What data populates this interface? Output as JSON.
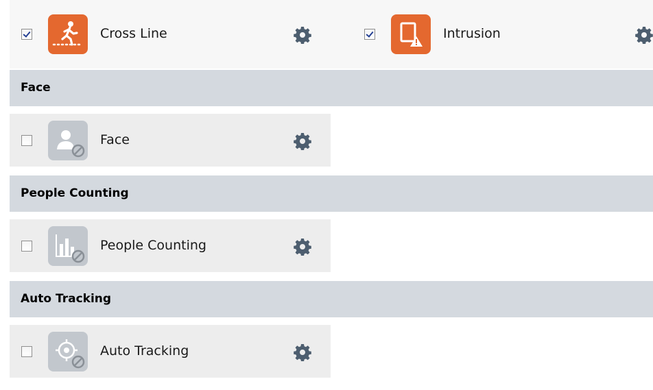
{
  "colors": {
    "row_background": "#ededed",
    "section_header_background": "#d4d9df",
    "active_tile": "#e4682f",
    "disabled_tile": "#c2c7cd",
    "gear": "#4d5e6f",
    "check": "#243f93"
  },
  "top_row": {
    "items": [
      {
        "label": "Cross Line",
        "checked": true,
        "icon": "cross-line-icon",
        "state": "active"
      },
      {
        "label": "Intrusion",
        "checked": true,
        "icon": "intrusion-icon",
        "state": "active"
      }
    ]
  },
  "sections": [
    {
      "header": "Face",
      "item": {
        "label": "Face",
        "checked": false,
        "icon": "face-icon",
        "state": "disabled"
      }
    },
    {
      "header": "People Counting",
      "item": {
        "label": "People Counting",
        "checked": false,
        "icon": "people-counting-icon",
        "state": "disabled"
      }
    },
    {
      "header": "Auto Tracking",
      "item": {
        "label": "Auto Tracking",
        "checked": false,
        "icon": "auto-tracking-icon",
        "state": "disabled"
      }
    }
  ]
}
